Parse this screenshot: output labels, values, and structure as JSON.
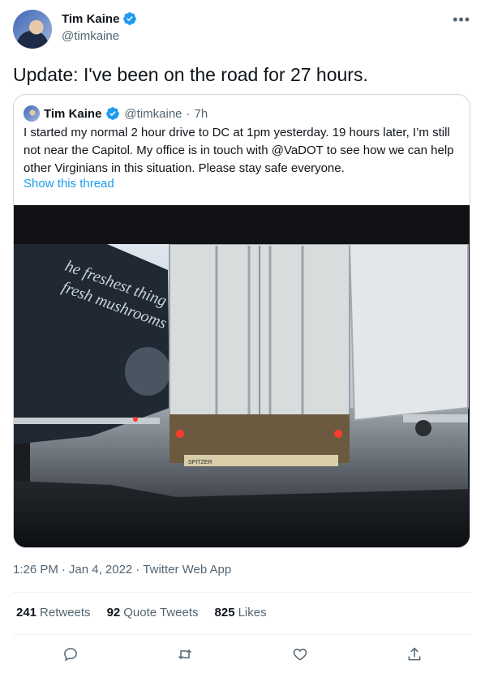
{
  "author": {
    "display_name": "Tim Kaine",
    "handle": "@timkaine",
    "verified_icon": "verified-badge-icon",
    "avatar_icon": "profile-photo"
  },
  "more_icon": "more-horizontal-icon",
  "more_glyph": "•••",
  "tweet": {
    "text": "Update: I've been on the road for 27 hours."
  },
  "quote": {
    "display_name": "Tim Kaine",
    "handle": "@timkaine",
    "separator": "·",
    "time": "7h",
    "text": "I started my normal 2 hour drive to DC at 1pm yesterday. 19 hours later, I’m still not near the Capitol. My office is in touch with @VaDOT to see how we can help other Virginians in this situation. Please stay safe everyone.",
    "thread_link": "Show this thread",
    "image_text_line1": "he freshest thing",
    "image_text_line2": "fresh mushrooms",
    "image_text_plate": "SPITZER"
  },
  "meta": {
    "time": "1:26 PM",
    "sep1": "·",
    "date": "Jan 4, 2022",
    "sep2": "·",
    "client": "Twitter Web App"
  },
  "stats": [
    {
      "num": "241",
      "label": "Retweets"
    },
    {
      "num": "92",
      "label": "Quote Tweets"
    },
    {
      "num": "825",
      "label": "Likes"
    }
  ],
  "actions": [
    "reply-icon",
    "retweet-icon",
    "like-icon",
    "share-icon"
  ],
  "colors": {
    "accent": "#1d9bf0",
    "text": "#0f1419",
    "secondary": "#536471",
    "border": "#cfd9de"
  }
}
